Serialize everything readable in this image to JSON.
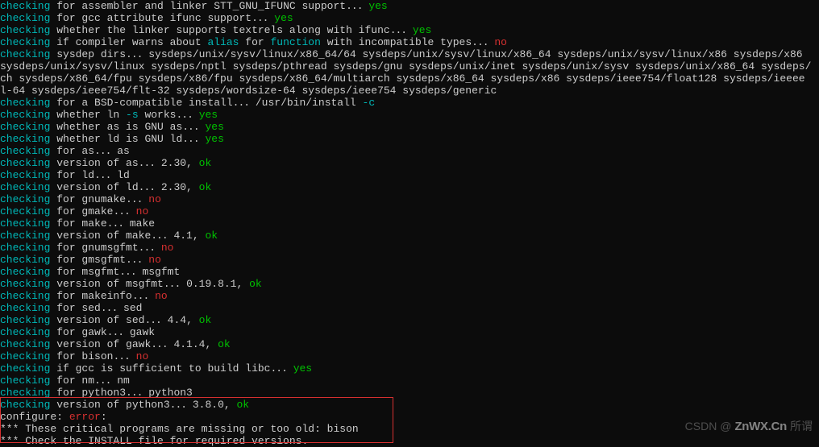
{
  "chk": "checking",
  "yes": "yes",
  "no": "no",
  "ok": "ok",
  "lines": {
    "l1": " for assembler and linker STT_GNU_IFUNC support",
    "l2": " for gcc attribute ifunc support",
    "l3": " whether the linker supports textrels along with ifunc",
    "l4a": " if compiler warns about ",
    "l4_alias": "alias",
    "l4b": " for ",
    "l4_func": "function",
    "l4c": " with incompatible types",
    "l5a": " sysdep dirs",
    "l5b": "  sysdeps/unix/sysv/linux/x86_64/64 sysdeps/unix/sysv/linux/x86_64 sysdeps/unix/sysv/linux/x86 sysdeps/x86",
    "l5c": "sysdeps/unix/sysv/linux sysdeps/nptl sysdeps/pthread sysdeps/gnu sysdeps/unix/inet sysdeps/unix/sysv sysdeps/unix/x86_64 sysdeps/",
    "l5d": "ch sysdeps/x86_64/fpu sysdeps/x86/fpu sysdeps/x86_64/multiarch sysdeps/x86_64 sysdeps/x86 sysdeps/ieee754/float128 sysdeps/ieeee",
    "l5e": "l-64 sysdeps/ieee754/flt-32 sysdeps/wordsize-64 sysdeps/ieee754 sysdeps/generic",
    "l6a": " for a BSD-compatible install",
    "l6b": "  /usr/bin/install ",
    "l6_c": "-c",
    "l7a": " whether ln ",
    "l7_s": "-s",
    "l7b": " works",
    "l8": " whether as is GNU as",
    "l9": " whether ld is GNU ld",
    "l10a": " for as",
    "l10b": "  as",
    "l11": " version of as",
    "l11v": "  2.30, ",
    "l12a": " for ld",
    "l12b": "  ld",
    "l13": " version of ld",
    "l13v": "  2.30, ",
    "l14": " for gnumake",
    "l15": " for gmake",
    "l16a": " for make",
    "l16b": "  make",
    "l17": " version of make",
    "l17v": "  4.1, ",
    "l18": " for gnumsgfmt",
    "l19": " for gmsgfmt",
    "l20a": " for msgfmt",
    "l20b": "  msgfmt",
    "l21": " version of msgfmt",
    "l21v": "  0.19.8.1, ",
    "l22": " for makeinfo",
    "l23a": " for sed",
    "l23b": "  sed",
    "l24": " version of sed",
    "l24v": "  4.4, ",
    "l25a": " for gawk",
    "l25b": "  gawk",
    "l26": " version of gawk",
    "l26v": "  4.1.4, ",
    "l27": " for bison",
    "l28": " if gcc is sufficient to build libc",
    "l29a": " for nm",
    "l29b": "  nm",
    "l30a": " for python3",
    "l30b": "  python3",
    "l31": " version of python3",
    "l31v": "  3.8.0, ",
    "l32a": "configure: ",
    "l32_err": "error",
    "l32b": ":",
    "l33": "*** These critical programs are missing or too old: bison",
    "l34": "*** Check the INSTALL file for required versions."
  },
  "dots": "...",
  "sp": " ",
  "sp2": "  ",
  "watermark": {
    "csdn": "CSDN @",
    "site": "ZnWX.Cn",
    "tail": "所谓"
  }
}
